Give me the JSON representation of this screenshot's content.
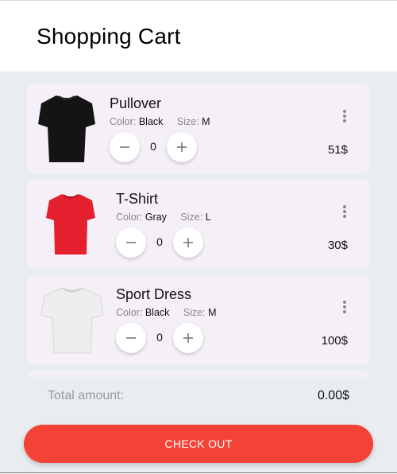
{
  "header": {
    "title": "Shopping Cart"
  },
  "labels": {
    "color": "Color:",
    "size": "Size:"
  },
  "items": [
    {
      "name": "Pullover",
      "color": "Black",
      "size": "M",
      "quantity": "0",
      "price": "51$",
      "image_icon": "black-tshirt",
      "shirt_color": "#141414"
    },
    {
      "name": "T-Shirt",
      "color": "Gray",
      "size": "L",
      "quantity": "0",
      "price": "30$",
      "image_icon": "red-tshirt",
      "shirt_color": "#e4202f"
    },
    {
      "name": "Sport Dress",
      "color": "Black",
      "size": "M",
      "quantity": "0",
      "price": "100$",
      "image_icon": "white-tshirt",
      "shirt_color": "#eeeeee"
    }
  ],
  "footer": {
    "total_label": "Total amount:",
    "total_value": "0.00$",
    "checkout_label": "CHECK OUT"
  },
  "colors": {
    "accent": "#f44336",
    "card_bg": "#f5f0f8",
    "page_bg": "#e9edf0"
  }
}
